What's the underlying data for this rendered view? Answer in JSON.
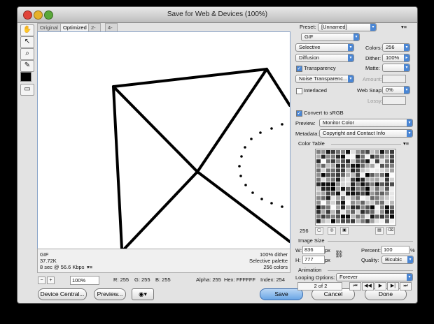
{
  "window": {
    "title": "Save for Web & Devices (100%)"
  },
  "tabs": [
    "Original",
    "Optimized",
    "2-Up",
    "4-Up"
  ],
  "info_left": [
    "GIF",
    "37.72K",
    "8 sec @ 56.6 Kbps"
  ],
  "info_right": [
    "100% dither",
    "Selective palette",
    "256 colors"
  ],
  "status": {
    "zoom": "100%",
    "r": "R: 255",
    "g": "G: 255",
    "b": "B: 255",
    "alpha": "Alpha: 255",
    "hex": "Hex: FFFFFF",
    "index": "Index: 254"
  },
  "buttons": {
    "device_central": "Device Central...",
    "preview": "Preview...",
    "save": "Save",
    "cancel": "Cancel",
    "done": "Done"
  },
  "settings": {
    "preset_label": "Preset:",
    "preset_value": "[Unnamed]",
    "format": "GIF",
    "reduction": "Selective",
    "colors_label": "Colors:",
    "colors_value": "256",
    "dither_algo": "Diffusion",
    "dither_label": "Dither:",
    "dither_value": "100%",
    "transparency_label": "Transparency",
    "transparency_checked": true,
    "matte_label": "Matte:",
    "transparency_dither": "Noise Transparenc...",
    "amount_label": "Amount:",
    "interlaced_label": "Interlaced",
    "interlaced_checked": false,
    "websnap_label": "Web Snap:",
    "websnap_value": "0%",
    "lossy_label": "Lossy:",
    "convert_srgb_label": "Convert to sRGB",
    "convert_srgb_checked": true,
    "preview_label": "Preview:",
    "preview_value": "Monitor Color",
    "metadata_label": "Metadata:",
    "metadata_value": "Copyright and Contact Info"
  },
  "color_table": {
    "title": "Color Table",
    "count": "256"
  },
  "image_size": {
    "title": "Image Size",
    "w_label": "W:",
    "w_value": "836",
    "w_unit": "px",
    "h_label": "H:",
    "h_value": "777",
    "h_unit": "px",
    "percent_label": "Percent:",
    "percent_value": "100",
    "percent_unit": "%",
    "quality_label": "Quality:",
    "quality_value": "Bicubic"
  },
  "animation": {
    "title": "Animation",
    "looping_label": "Looping Options:",
    "looping_value": "Forever",
    "frame": "2 of 2"
  },
  "icons": [
    "hand-icon",
    "slice-select-icon",
    "zoom-icon",
    "eyedropper-icon",
    "eyedropper-color-swatch",
    "toggle-slices-icon",
    "panel-menu-icon",
    "link-icon"
  ]
}
